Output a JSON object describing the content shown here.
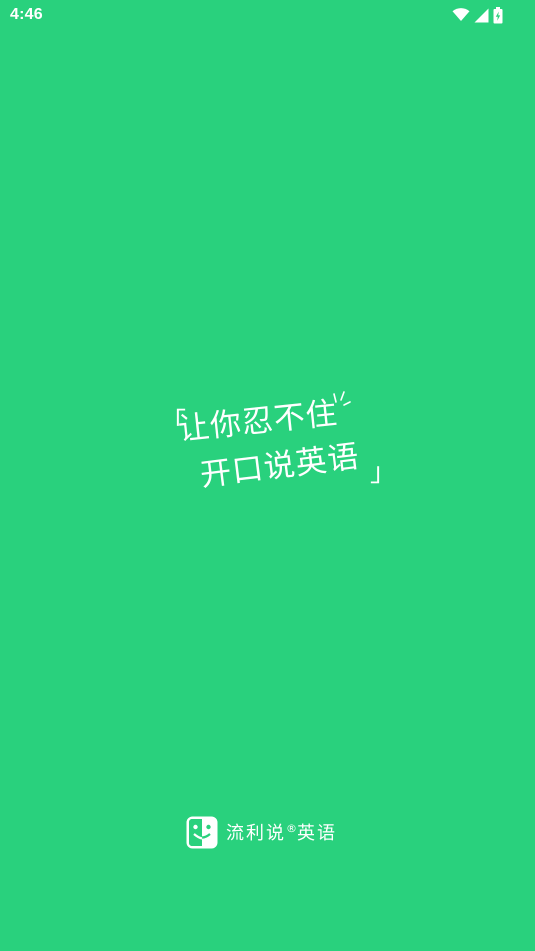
{
  "status_bar": {
    "time": "4:46",
    "icons": [
      "wifi-icon",
      "cellular-signal-icon",
      "battery-charging-icon"
    ]
  },
  "slogan": {
    "open_quote": "「",
    "line1": "让你忍不住",
    "line2": "开口说英语",
    "close_quote": "」"
  },
  "brand": {
    "name_part1": "流利说",
    "registered_mark": "®",
    "name_part2": "英语",
    "icon": "liulishuo-logo-icon"
  },
  "colors": {
    "background": "#29D17D",
    "foreground": "#FFFFFF"
  }
}
